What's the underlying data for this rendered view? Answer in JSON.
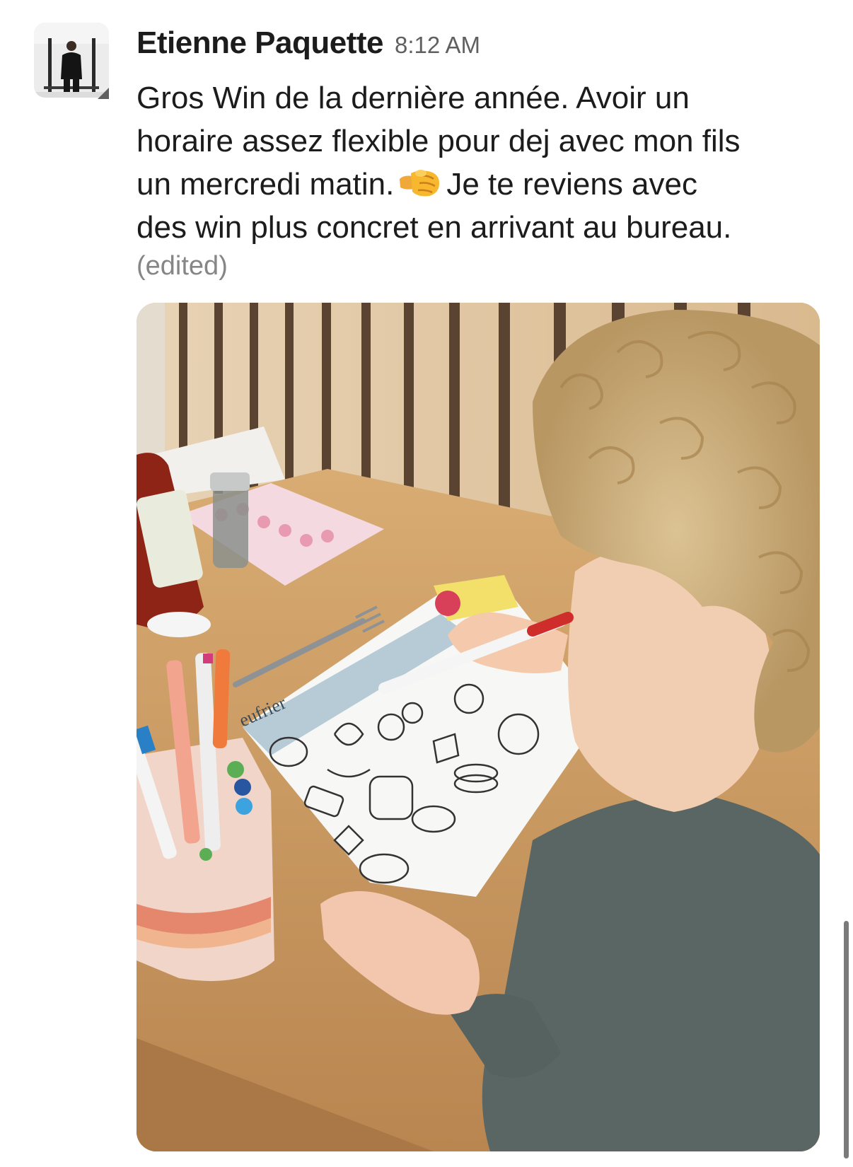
{
  "message": {
    "sender_name": "Etienne Paquette",
    "timestamp": "8:12 AM",
    "lines": [
      "Gros Win de la dernière année. Avoir un",
      "horaire assez flexible pour dej avec mon fils",
      "un mercredi matin.",
      "Je te reviens avec",
      "des win plus concret en arrivant au bureau."
    ],
    "emoji": "right-facing-fist-emoji",
    "edited_label": "(edited)",
    "avatar_icon": "user-avatar-photo",
    "attachment": "image-child-coloring-placemat",
    "placemat_text": "eufrier"
  },
  "colors": {
    "text": "#1d1c1d",
    "muted": "#616061",
    "edited": "#868686"
  }
}
